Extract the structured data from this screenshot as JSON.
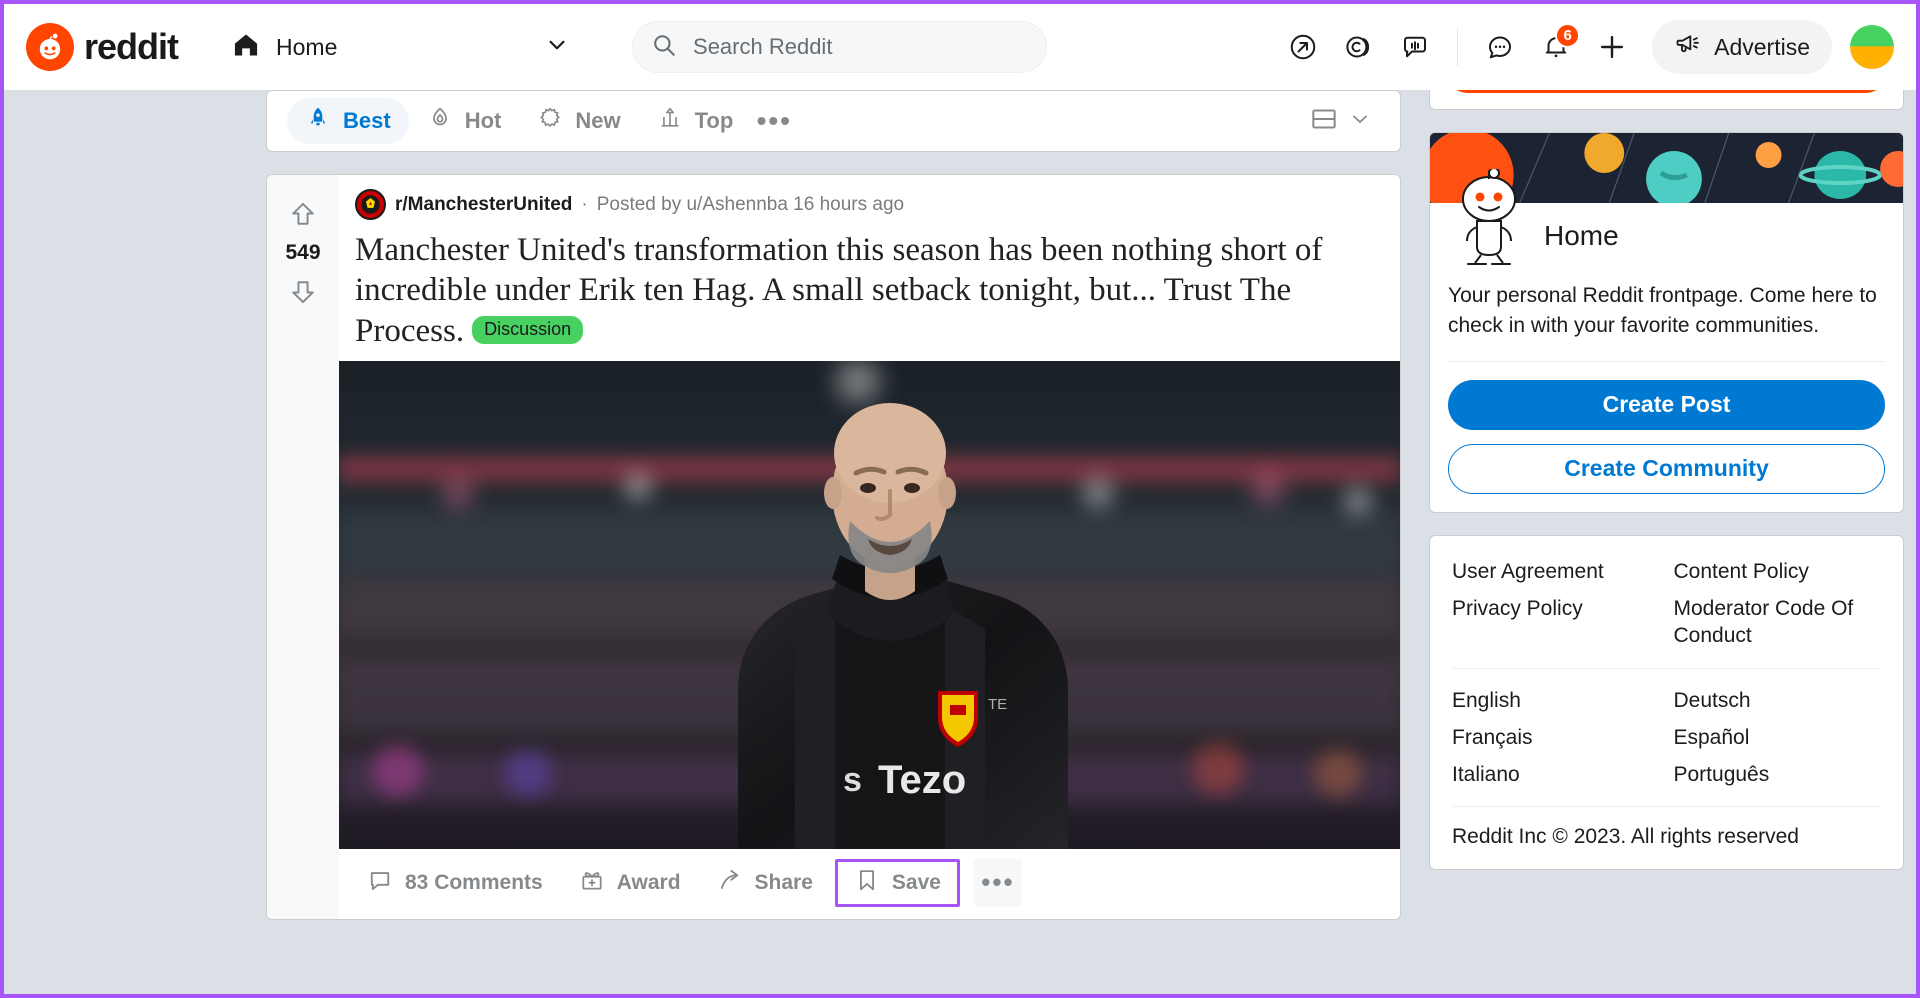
{
  "header": {
    "logo_text": "reddit",
    "logo_icon": "reddit-snoo-logo",
    "home_label": "Home",
    "home_icon": "house-icon",
    "chevron_icon": "chevron-down-icon",
    "search": {
      "placeholder": "Search Reddit",
      "value": "",
      "icon": "search-icon"
    },
    "icons": [
      {
        "name": "popular-icon",
        "title": "Popular"
      },
      {
        "name": "coins-icon",
        "title": "Coins"
      },
      {
        "name": "talk-icon",
        "title": "Talk"
      },
      {
        "name": "chat-icon",
        "title": "Chat"
      },
      {
        "name": "notifications-bell-icon",
        "title": "Notifications",
        "badge": "6"
      },
      {
        "name": "plus-create-icon",
        "title": "Create Post"
      }
    ],
    "notification_badge": "6",
    "advertise_label": "Advertise",
    "advertise_icon": "megaphone-icon",
    "avatar": "user-avatar"
  },
  "sortbar": {
    "tabs": [
      {
        "label": "Best",
        "icon": "rocket-icon",
        "active": true
      },
      {
        "label": "Hot",
        "icon": "flame-icon",
        "active": false
      },
      {
        "label": "New",
        "icon": "starburst-icon",
        "active": false
      },
      {
        "label": "Top",
        "icon": "chart-arrow-icon",
        "active": false
      }
    ],
    "more_label": "•••",
    "view_icon": "card-view-icon",
    "view_chevron": "chevron-down-icon"
  },
  "post": {
    "votes": "549",
    "upvote_icon": "upvote-arrow-icon",
    "downvote_icon": "downvote-arrow-icon",
    "subreddit": "r/ManchesterUnited",
    "subreddit_icon": "manchester-united-crest-icon",
    "separator": "·",
    "posted_by": "Posted by u/Ashennba 16 hours ago",
    "title": "Manchester United's transformation this season has been nothing short of incredible under Erik ten Hag. A small setback tonight, but... Trust The Process.",
    "flair": "Discussion",
    "flair_color": "#46d160",
    "image_alt": "Erik ten Hag in a dark Manchester United jacket on the pitch",
    "actions": [
      {
        "label": "83 Comments",
        "icon": "comment-bubble-icon",
        "highlighted": false
      },
      {
        "label": "Award",
        "icon": "award-gift-icon",
        "highlighted": false
      },
      {
        "label": "Share",
        "icon": "share-arrow-icon",
        "highlighted": false
      },
      {
        "label": "Save",
        "icon": "bookmark-icon",
        "highlighted": true
      }
    ],
    "more_label": "•••"
  },
  "sidebar": {
    "promo_partial": "",
    "home_card": {
      "title": "Home",
      "icon": "snoo-mascot-icon",
      "description": "Your personal Reddit frontpage. Come here to check in with your favorite communities.",
      "create_post_label": "Create Post",
      "create_community_label": "Create Community"
    },
    "footer": {
      "links": [
        "User Agreement",
        "Content Policy",
        "Privacy Policy",
        "Moderator Code Of Conduct"
      ],
      "languages": [
        "English",
        "Deutsch",
        "Français",
        "Español",
        "Italiano",
        "Português"
      ],
      "copyright": "Reddit Inc © 2023. All rights reserved"
    }
  },
  "colors": {
    "brand_orange": "#ff4500",
    "link_blue": "#0079d3",
    "flair_green": "#46d160",
    "highlight_purple": "#a855f7",
    "page_bg": "#dae0e6"
  }
}
